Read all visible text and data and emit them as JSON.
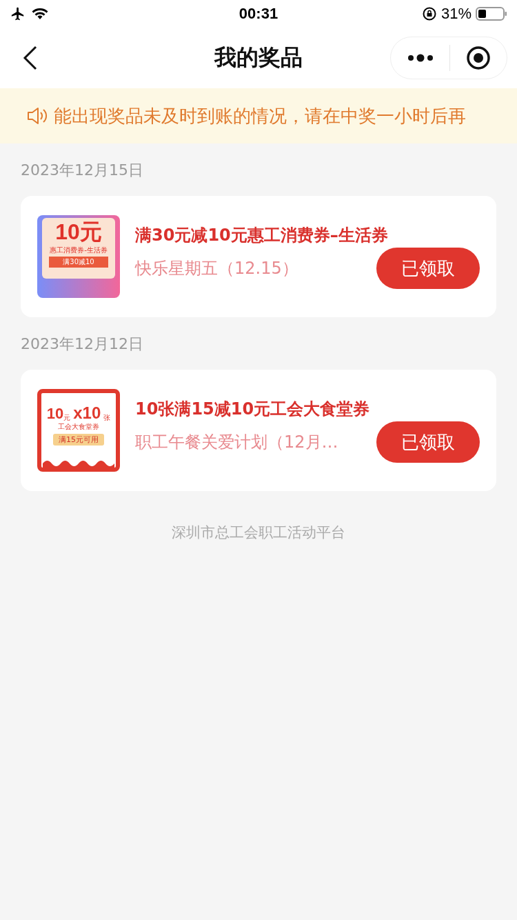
{
  "status_bar": {
    "time": "00:31",
    "battery": "31%"
  },
  "nav": {
    "title": "我的奖品"
  },
  "notice": {
    "text": "能出现奖品未及时到账的情况，请在中奖一小时后再"
  },
  "groups": [
    {
      "date": "2023年12月15日",
      "prizes": [
        {
          "kind": "voucher",
          "thumb": {
            "amount": "10元",
            "name": "惠工消费券-生活券",
            "rule": "满30减10"
          },
          "title": "满30元减10元惠工消费券–生活券",
          "subtitle": "快乐星期五（12.15）",
          "button": "已领取"
        }
      ]
    },
    {
      "date": "2023年12月12日",
      "prizes": [
        {
          "kind": "ticket",
          "thumb": {
            "amount": "10",
            "unit": "元",
            "name": "工会大食堂券",
            "count": "x10",
            "count_unit": "张",
            "rule": "满15元可用"
          },
          "title": "10张满15减10元工会大食堂券",
          "subtitle": "职工午餐关爱计划（12月…",
          "button": "已领取"
        }
      ]
    }
  ],
  "footer": "深圳市总工会职工活动平台"
}
